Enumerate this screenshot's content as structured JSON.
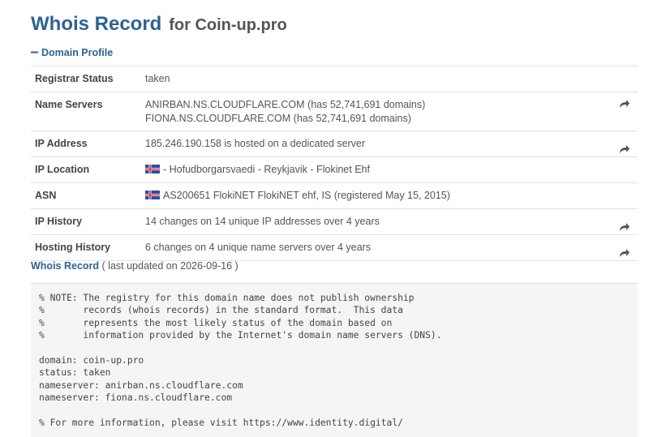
{
  "header": {
    "title": "Whois Record",
    "subtitle": "for Coin-up.pro"
  },
  "profile": {
    "toggle_label": "Domain Profile",
    "rows": [
      {
        "label": "Registrar Status",
        "value": "taken"
      },
      {
        "label": "Name Servers",
        "value_lines": [
          "ANIRBAN.NS.CLOUDFLARE.COM (has 52,741,691 domains)",
          "FIONA.NS.CLOUDFLARE.COM (has 52,741,691 domains)"
        ]
      },
      {
        "label": "IP Address",
        "value": "185.246.190.158 is hosted on a dedicated server"
      },
      {
        "label": "IP Location",
        "value": "- Hofudborgarsvaedi - Reykjavik - Flokinet Ehf"
      },
      {
        "label": "ASN",
        "value": "AS200651 FlokiNET FlokiNET ehf, IS (registered May 15, 2015)"
      },
      {
        "label": "IP History",
        "value": "14 changes on 14 unique IP addresses over 4 years"
      },
      {
        "label": "Hosting History",
        "value": "6 changes on 4 unique name servers over 4 years"
      }
    ]
  },
  "whois": {
    "title": "Whois Record",
    "updated": "( last updated on 2026-09-16 )",
    "raw": "% NOTE: The registry for this domain name does not publish ownership\n%       records (whois records) in the standard format.  This data\n%       represents the most likely status of the domain based on\n%       information provided by the Internet's domain name servers (DNS).\n\ndomain: coin-up.pro\nstatus: taken\nnameserver: anirban.ns.cloudflare.com\nnameserver: fiona.ns.cloudflare.com\n\n% For more information, please visit https://www.identity.digital/"
  },
  "icons": {
    "share": "share-arrow-icon",
    "flag": "iceland-flag-icon",
    "collapse": "minus-icon"
  },
  "colors": {
    "accent": "#2e6392",
    "text": "#555555",
    "border": "#e2e2e2",
    "pre_bg": "#f5f5f5"
  }
}
